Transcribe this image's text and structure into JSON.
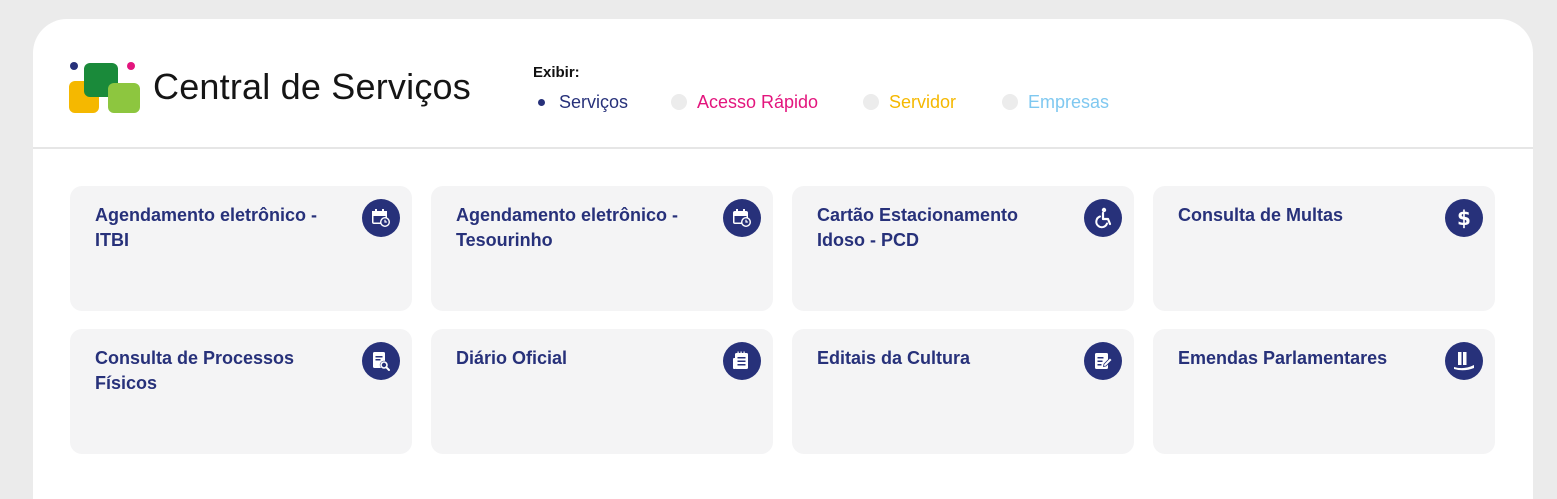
{
  "header": {
    "title": "Central de Serviços",
    "filter_label": "Exibir:",
    "filter_options": [
      {
        "label": "Serviços",
        "color": "#27317a",
        "selected": true
      },
      {
        "label": "Acesso Rápido",
        "color": "#e3157d",
        "selected": false
      },
      {
        "label": "Servidor",
        "color": "#f5b800",
        "selected": false
      },
      {
        "label": "Empresas",
        "color": "#7fc8f0",
        "selected": false
      }
    ]
  },
  "cards": [
    {
      "title": "Agendamento eletrônico - ITBI",
      "icon": "calendar-clock-icon"
    },
    {
      "title": "Agendamento eletrônico - Tesourinho",
      "icon": "calendar-clock-icon"
    },
    {
      "title": "Cartão Estacionamento Idoso - PCD",
      "icon": "wheelchair-icon"
    },
    {
      "title": "Consulta de Multas",
      "icon": "dollar-icon"
    },
    {
      "title": "Consulta de Processos Físicos",
      "icon": "document-search-icon"
    },
    {
      "title": "Diário Oficial",
      "icon": "newspaper-icon"
    },
    {
      "title": "Editais da Cultura",
      "icon": "document-edit-icon"
    },
    {
      "title": "Emendas Parlamentares",
      "icon": "podium-icon"
    }
  ],
  "colors": {
    "primary": "#27317a",
    "logo_blue": "#27317a",
    "logo_green_dark": "#1a8a3a",
    "logo_yellow": "#f5b800",
    "logo_green_light": "#8dc63f",
    "logo_pink": "#e3157d"
  }
}
